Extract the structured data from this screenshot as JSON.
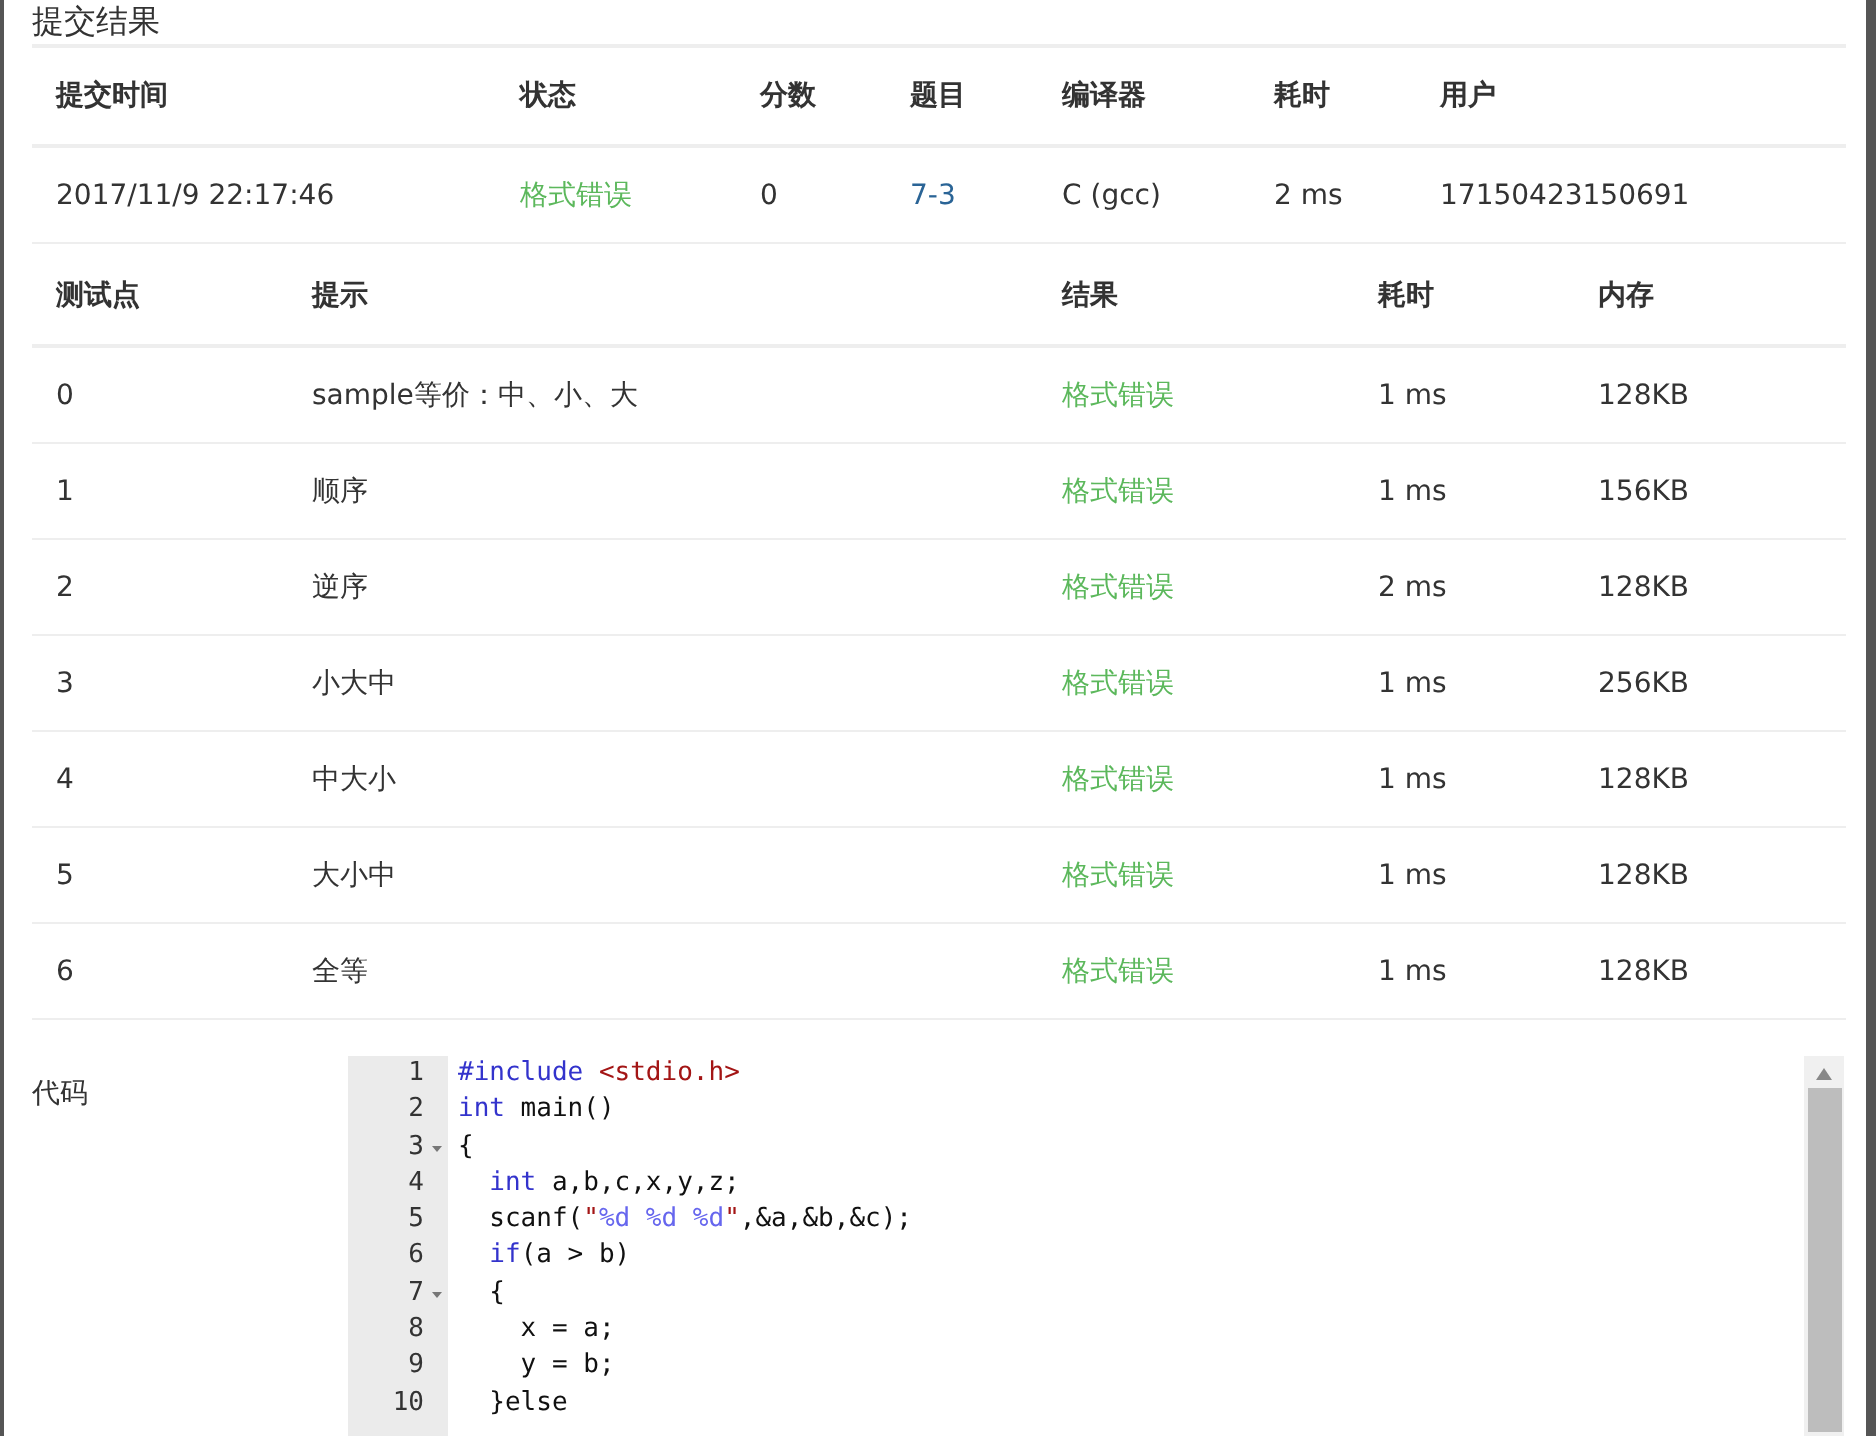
{
  "title": "提交结果",
  "summary": {
    "columns": [
      "提交时间",
      "状态",
      "分数",
      "题目",
      "编译器",
      "耗时",
      "用户"
    ],
    "rows": [
      [
        {
          "kind": "text",
          "text": "2017/11/9 22:17:46"
        },
        {
          "kind": "status",
          "text": "格式错误"
        },
        {
          "kind": "text",
          "text": "0"
        },
        {
          "kind": "link",
          "text": "7-3"
        },
        {
          "kind": "text",
          "text": "C (gcc)"
        },
        {
          "kind": "text",
          "text": "2 ms"
        },
        {
          "kind": "text",
          "text": "17150423150691"
        }
      ]
    ]
  },
  "tests": {
    "columns": [
      "测试点",
      "提示",
      "结果",
      "耗时",
      "内存"
    ],
    "rows": [
      [
        {
          "kind": "text",
          "text": "0"
        },
        {
          "kind": "text",
          "text": "sample等价：中、小、大"
        },
        {
          "kind": "status",
          "text": "格式错误"
        },
        {
          "kind": "text",
          "text": "1 ms"
        },
        {
          "kind": "text",
          "text": "128KB"
        }
      ],
      [
        {
          "kind": "text",
          "text": "1"
        },
        {
          "kind": "text",
          "text": "顺序"
        },
        {
          "kind": "status",
          "text": "格式错误"
        },
        {
          "kind": "text",
          "text": "1 ms"
        },
        {
          "kind": "text",
          "text": "156KB"
        }
      ],
      [
        {
          "kind": "text",
          "text": "2"
        },
        {
          "kind": "text",
          "text": "逆序"
        },
        {
          "kind": "status",
          "text": "格式错误"
        },
        {
          "kind": "text",
          "text": "2 ms"
        },
        {
          "kind": "text",
          "text": "128KB"
        }
      ],
      [
        {
          "kind": "text",
          "text": "3"
        },
        {
          "kind": "text",
          "text": "小大中"
        },
        {
          "kind": "status",
          "text": "格式错误"
        },
        {
          "kind": "text",
          "text": "1 ms"
        },
        {
          "kind": "text",
          "text": "256KB"
        }
      ],
      [
        {
          "kind": "text",
          "text": "4"
        },
        {
          "kind": "text",
          "text": "中大小"
        },
        {
          "kind": "status",
          "text": "格式错误"
        },
        {
          "kind": "text",
          "text": "1 ms"
        },
        {
          "kind": "text",
          "text": "128KB"
        }
      ],
      [
        {
          "kind": "text",
          "text": "5"
        },
        {
          "kind": "text",
          "text": "大小中"
        },
        {
          "kind": "status",
          "text": "格式错误"
        },
        {
          "kind": "text",
          "text": "1 ms"
        },
        {
          "kind": "text",
          "text": "128KB"
        }
      ],
      [
        {
          "kind": "text",
          "text": "6"
        },
        {
          "kind": "text",
          "text": "全等"
        },
        {
          "kind": "status",
          "text": "格式错误"
        },
        {
          "kind": "text",
          "text": "1 ms"
        },
        {
          "kind": "text",
          "text": "128KB"
        }
      ]
    ]
  },
  "code": {
    "label": "代码",
    "lines": [
      {
        "number": "1",
        "fold": false,
        "tokens": [
          {
            "kind": "keyword",
            "text": "#include"
          },
          {
            "kind": "string",
            "text": " <stdio.h>"
          }
        ]
      },
      {
        "number": "2",
        "fold": false,
        "tokens": [
          {
            "kind": "keyword",
            "text": "int"
          },
          {
            "kind": "plain",
            "text": " main()"
          }
        ]
      },
      {
        "number": "3",
        "fold": true,
        "tokens": [
          {
            "kind": "plain",
            "text": "{"
          }
        ]
      },
      {
        "number": "4",
        "fold": false,
        "tokens": [
          {
            "kind": "keyword",
            "text": "  int"
          },
          {
            "kind": "plain",
            "text": " a,b,c,x,y,z;"
          }
        ]
      },
      {
        "number": "5",
        "fold": false,
        "tokens": [
          {
            "kind": "plain",
            "text": "  scanf("
          },
          {
            "kind": "string",
            "text": "\""
          },
          {
            "kind": "format",
            "text": "%d %d %d"
          },
          {
            "kind": "string",
            "text": "\""
          },
          {
            "kind": "plain",
            "text": ",&a,&b,&c);"
          }
        ]
      },
      {
        "number": "6",
        "fold": false,
        "tokens": [
          {
            "kind": "keyword",
            "text": "  if"
          },
          {
            "kind": "plain",
            "text": "(a > b)"
          }
        ]
      },
      {
        "number": "7",
        "fold": true,
        "tokens": [
          {
            "kind": "plain",
            "text": "  {"
          }
        ]
      },
      {
        "number": "8",
        "fold": false,
        "tokens": [
          {
            "kind": "plain",
            "text": "    x = a;"
          }
        ]
      },
      {
        "number": "9",
        "fold": false,
        "tokens": [
          {
            "kind": "plain",
            "text": "    y = b;"
          }
        ]
      },
      {
        "number": "10",
        "fold": false,
        "tokens": [
          {
            "kind": "plain",
            "text": "  }else"
          }
        ]
      }
    ]
  }
}
